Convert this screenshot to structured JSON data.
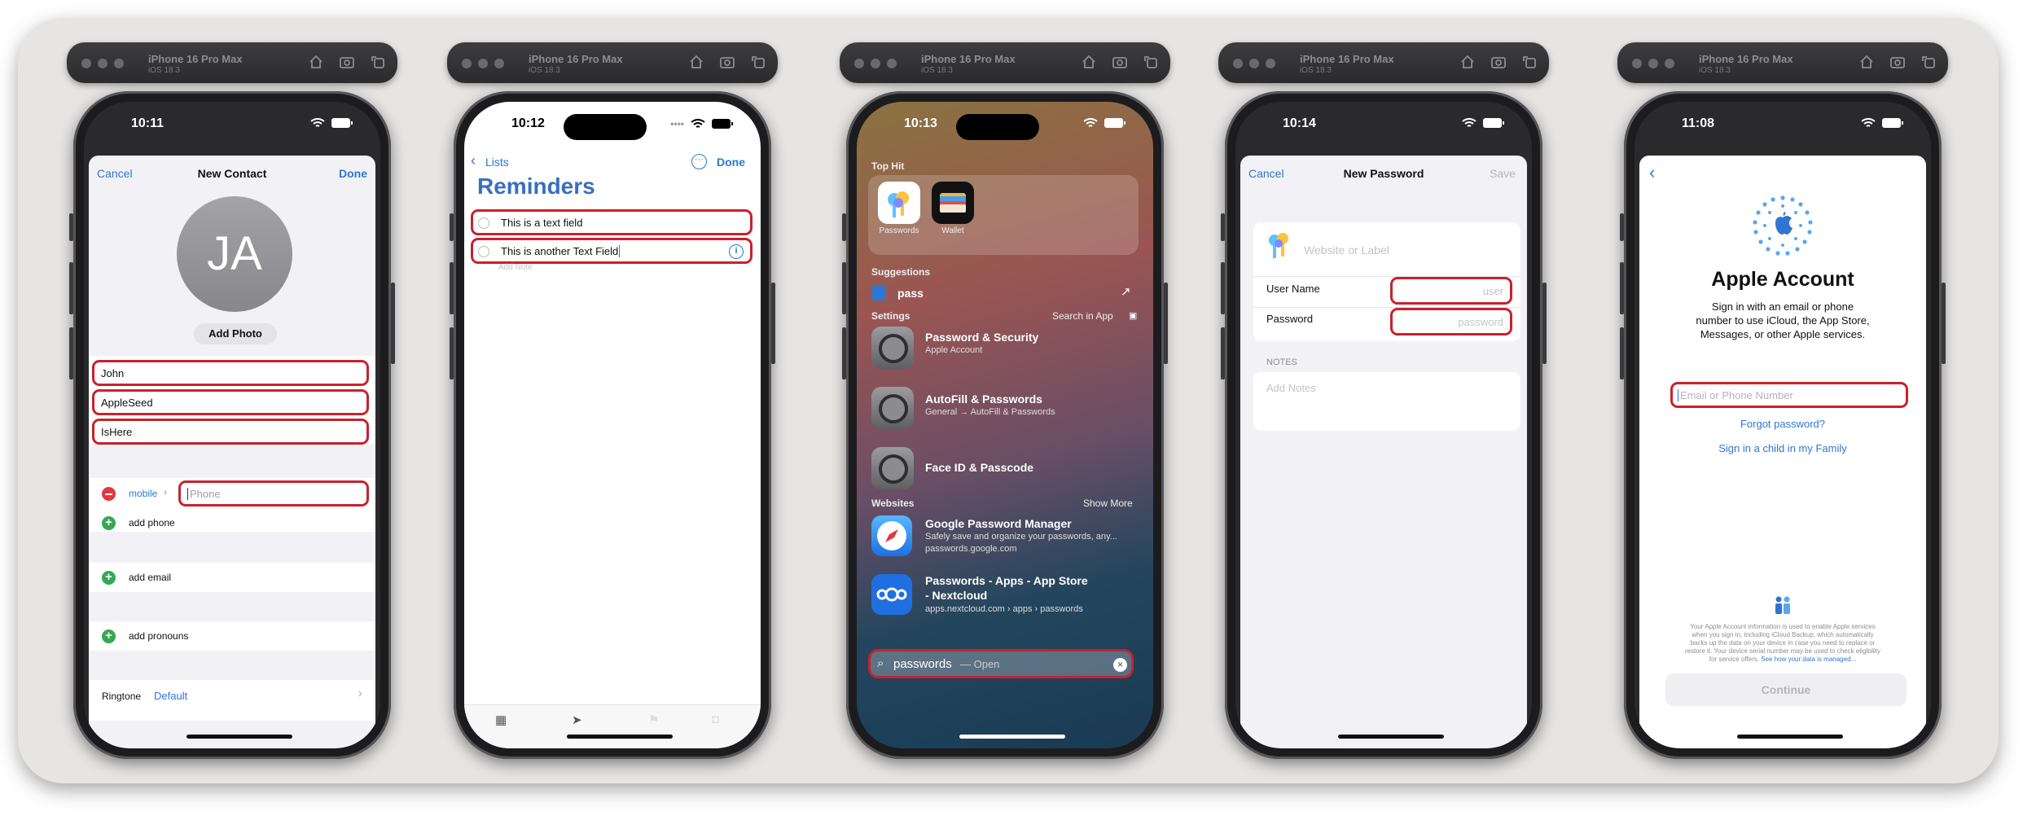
{
  "simulators": [
    {
      "device": "iPhone 16 Pro Max",
      "os": "iOS 18.3"
    },
    {
      "device": "iPhone 16 Pro Max",
      "os": "iOS 18.3"
    },
    {
      "device": "iPhone 16 Pro Max",
      "os": "iOS 18.3"
    },
    {
      "device": "iPhone 16 Pro Max",
      "os": "iOS 18.3"
    },
    {
      "device": "iPhone 16 Pro Max",
      "os": "iOS 18.3"
    }
  ],
  "contact": {
    "time": "10:11",
    "cancel": "Cancel",
    "title": "New Contact",
    "done": "Done",
    "initials": "JA",
    "add_photo": "Add Photo",
    "first_name": "John",
    "last_name": "AppleSeed",
    "company": "IsHere",
    "phone_label": "mobile",
    "phone_placeholder": "Phone",
    "add_phone": "add phone",
    "add_email": "add email",
    "add_pronouns": "add pronouns",
    "ringtone_label": "Ringtone",
    "ringtone_value": "Default"
  },
  "reminders": {
    "time": "10:12",
    "back": "Lists",
    "done": "Done",
    "title": "Reminders",
    "item1": "This is a text field",
    "item2": "This is another Text Field",
    "add_note": "Add Note"
  },
  "spotlight": {
    "time": "10:13",
    "top_hit": "Top Hit",
    "app1": "Passwords",
    "app2": "Wallet",
    "suggestions": "Suggestions",
    "suggestion": "pass",
    "settings": "Settings",
    "search_in_app": "Search in App",
    "s1_title": "Password & Security",
    "s1_sub": "Apple Account",
    "s2_title": "AutoFill & Passwords",
    "s2_sub": "General → AutoFill & Passwords",
    "s3_title": "Face ID & Passcode",
    "websites": "Websites",
    "show_more": "Show More",
    "w1_title": "Google Password Manager",
    "w1_sub": "Safely save and organize your passwords, any...",
    "w1_url": "passwords.google.com",
    "w2_title1": "Passwords - Apps - App Store",
    "w2_title2": "- Nextcloud",
    "w2_url": "apps.nextcloud.com › apps › passwords",
    "search_text": "passwords",
    "search_hint": "— Open"
  },
  "password": {
    "time": "10:14",
    "cancel": "Cancel",
    "title": "New Password",
    "save": "Save",
    "website_placeholder": "Website or Label",
    "user_label": "User Name",
    "user_placeholder": "user",
    "pass_label": "Password",
    "pass_placeholder": "password",
    "notes_header": "NOTES",
    "notes_placeholder": "Add Notes"
  },
  "account": {
    "time": "11:08",
    "title": "Apple Account",
    "desc1": "Sign in with an email or phone",
    "desc2": "number to use iCloud, the App Store,",
    "desc3": "Messages, or other Apple services.",
    "email_placeholder": "Email or Phone Number",
    "forgot": "Forgot password?",
    "child": "Sign in a child in my Family",
    "fine1": "Your Apple Account information is used to enable Apple services",
    "fine2": "when you sign in, including iCloud Backup, which automatically",
    "fine3": "backs up the data on your device in case you need to replace or",
    "fine4": "restore it. Your device serial number may be used to check eligibility",
    "fine5": "for service offers.",
    "fine_link": "See how your data is managed...",
    "continue": "Continue"
  },
  "colors": {
    "accent": "#2f76d2",
    "highlight": "#c8222d",
    "green": "#34a853"
  }
}
